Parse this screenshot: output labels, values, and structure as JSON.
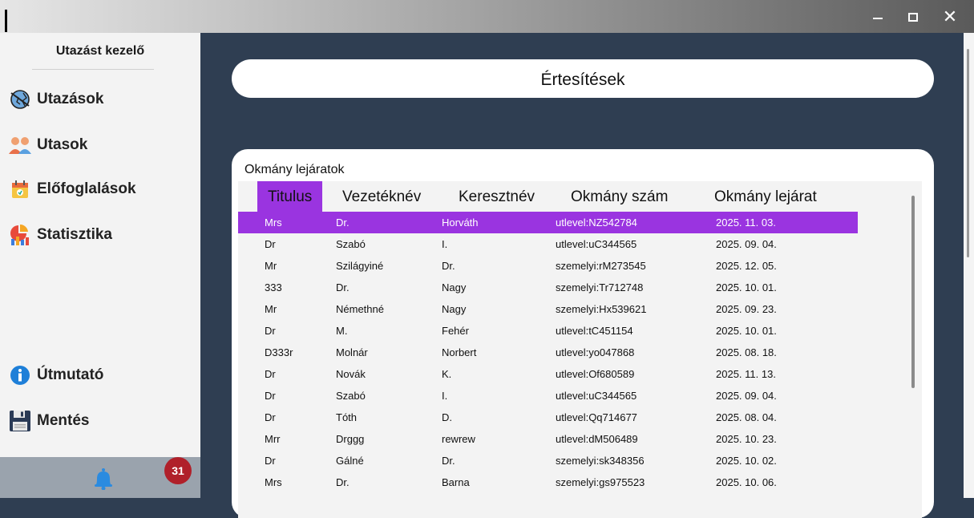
{
  "window": {
    "minimize": "–",
    "close": "✕"
  },
  "sidebar": {
    "title": "Utazást kezelő",
    "items": [
      {
        "label": "Utazások",
        "icon": "globe-plane-icon"
      },
      {
        "label": "Utasok",
        "icon": "people-icon"
      },
      {
        "label": "Előfoglalások",
        "icon": "calendar-icon"
      },
      {
        "label": "Statisztika",
        "icon": "chart-icon"
      }
    ],
    "bottom_items": [
      {
        "label": "Útmutató",
        "icon": "info-icon"
      },
      {
        "label": "Mentés",
        "icon": "save-icon"
      }
    ],
    "notification_count": "31"
  },
  "header": {
    "title": "Értesítések"
  },
  "section": {
    "title": "Okmány lejáratok",
    "columns": [
      "Titulus",
      "Vezetéknév",
      "Keresztnév",
      "Okmány szám",
      "Okmány lejárat"
    ],
    "rows": [
      [
        "Mrs",
        "Dr.",
        "Horváth",
        "utlevel:NZ542784",
        "2025. 11. 03."
      ],
      [
        "Dr",
        "Szabó",
        "I.",
        "utlevel:uC344565",
        "2025. 09. 04."
      ],
      [
        "Mr",
        "Szilágyiné",
        "Dr.",
        "szemelyi:rM273545",
        "2025. 12. 05."
      ],
      [
        "333",
        "Dr.",
        "Nagy",
        "szemelyi:Tr712748",
        "2025. 10. 01."
      ],
      [
        "Mr",
        "Némethné",
        "Nagy",
        "szemelyi:Hx539621",
        "2025. 09. 23."
      ],
      [
        "Dr",
        "M.",
        "Fehér",
        "utlevel:tC451154",
        "2025. 10. 01."
      ],
      [
        "D333r",
        "Molnár",
        "Norbert",
        "utlevel:yo047868",
        "2025. 08. 18."
      ],
      [
        "Dr",
        "Novák",
        "K.",
        "utlevel:Of680589",
        "2025. 11. 13."
      ],
      [
        "Dr",
        "Szabó",
        "I.",
        "utlevel:uC344565",
        "2025. 09. 04."
      ],
      [
        "Dr",
        "Tóth",
        "D.",
        "utlevel:Qq714677",
        "2025. 08. 04."
      ],
      [
        "Mrr",
        "Drggg",
        "rewrew",
        "utlevel:dM506489",
        "2025. 10. 23."
      ],
      [
        "Dr",
        "Gálné",
        "Dr.",
        "szemelyi:sk348356",
        "2025. 10. 02."
      ],
      [
        "Mrs",
        "Dr.",
        "Barna",
        "szemelyi:gs975523",
        "2025. 10. 06."
      ]
    ]
  },
  "colors": {
    "accent": "#9a34e0",
    "background": "#2f3e52",
    "badge": "#b0202a"
  }
}
